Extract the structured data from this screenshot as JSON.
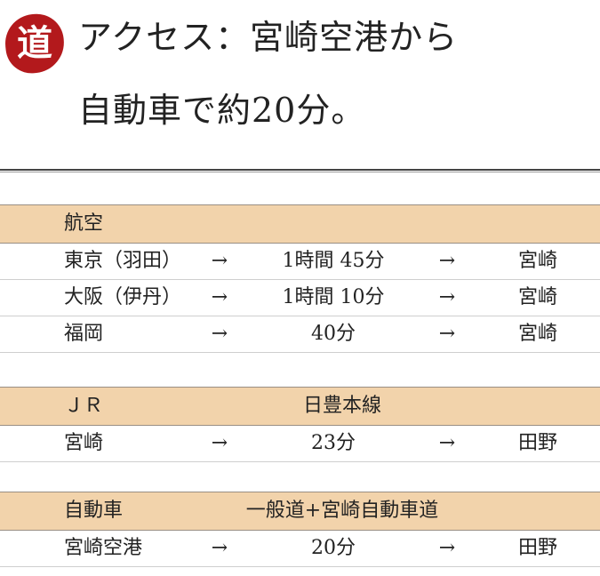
{
  "badge": "道",
  "title": {
    "line1": "アクセス：宮崎空港から",
    "line2": "自動車で約20分。"
  },
  "sections": [
    {
      "name": "航空",
      "route": "",
      "rows": [
        {
          "from": "東京（羽田）",
          "arrow1": "→",
          "time": "1時間 45分",
          "arrow2": "→",
          "to": "宮崎"
        },
        {
          "from": "大阪（伊丹）",
          "arrow1": "→",
          "time": "1時間 10分",
          "arrow2": "→",
          "to": "宮崎"
        },
        {
          "from": "福岡",
          "arrow1": "→",
          "time": "40分",
          "arrow2": "→",
          "to": "宮崎"
        }
      ]
    },
    {
      "name": "ＪＲ",
      "route": "日豊本線",
      "rows": [
        {
          "from": "宮崎",
          "arrow1": "→",
          "time": "23分",
          "arrow2": "→",
          "to": "田野"
        }
      ]
    },
    {
      "name": "自動車",
      "route": "一般道+宮崎自動車道",
      "rows": [
        {
          "from": "宮崎空港",
          "arrow1": "→",
          "time": "20分",
          "arrow2": "→",
          "to": "田野"
        }
      ]
    }
  ]
}
